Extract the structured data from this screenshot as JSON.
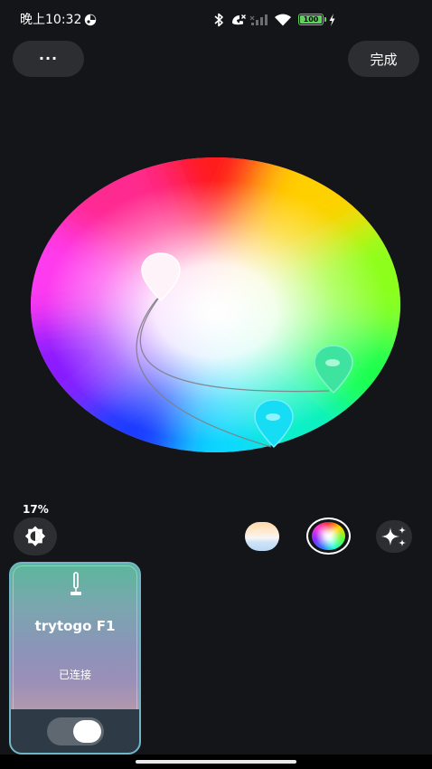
{
  "status_bar": {
    "time": "晚上10:32",
    "battery_level": "100"
  },
  "top_bar": {
    "more_label": "···",
    "done_label": "完成"
  },
  "color_picker": {
    "pins": [
      {
        "name": "white",
        "color": "#fff4fb"
      },
      {
        "name": "green",
        "color": "#39e6a1"
      },
      {
        "name": "cyan",
        "color": "#1ad9f0"
      }
    ]
  },
  "brightness": {
    "percent_label": "17%",
    "value": 17
  },
  "modes": [
    {
      "id": "white",
      "selected": false
    },
    {
      "id": "color",
      "selected": true
    },
    {
      "id": "effect",
      "selected": false
    }
  ],
  "device_card": {
    "name": "trytogo F1",
    "status": "已连接",
    "power_on": true
  },
  "colors": {
    "background": "#131518",
    "button": "#2c2e31",
    "card_border": "#6fb7c8",
    "battery": "#5fd35b"
  }
}
